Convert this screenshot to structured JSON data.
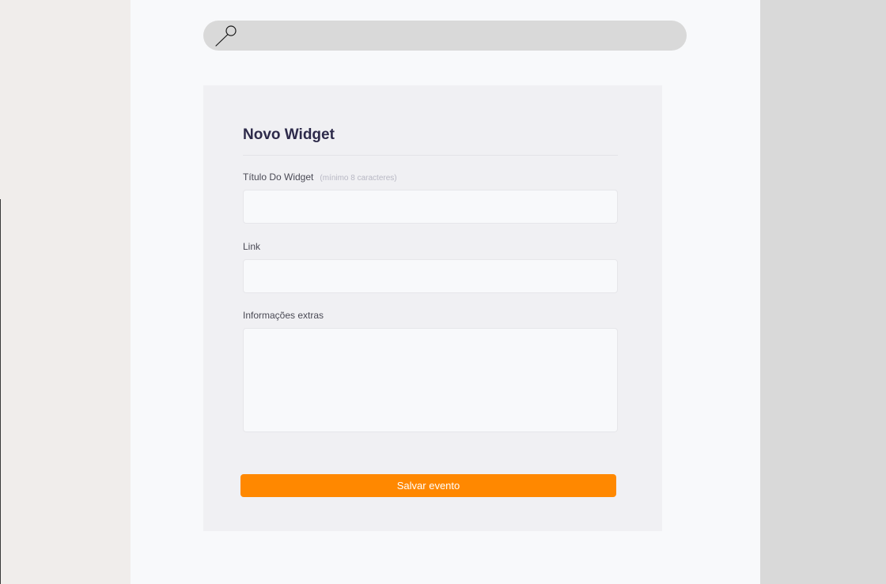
{
  "search": {
    "icon": "search-icon",
    "placeholder": ""
  },
  "form": {
    "title": "Novo Widget",
    "fields": {
      "widget_title": {
        "label": "Título Do Widget",
        "hint": "(mínimo 8 caracteres)",
        "value": ""
      },
      "link": {
        "label": "Link",
        "value": ""
      },
      "extra_info": {
        "label": "Informações  extras",
        "value": ""
      }
    },
    "save_label": "Salvar evento"
  },
  "colors": {
    "accent": "#ff8800",
    "title": "#2d2a4a",
    "sidebar_right": "#d9d9d9",
    "background_left": "#f0edeb"
  }
}
